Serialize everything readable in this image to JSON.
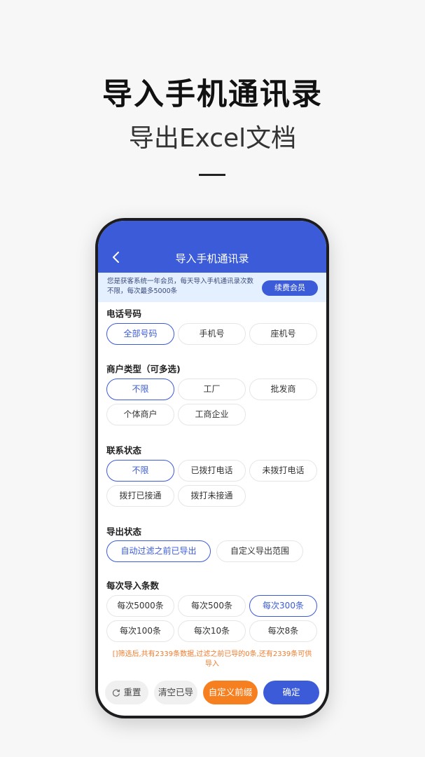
{
  "promo": {
    "title": "导入手机通讯录",
    "subtitle": "导出Excel文档"
  },
  "header": {
    "title": "导入手机通讯录",
    "back_icon": "chevron-left-icon"
  },
  "notice": {
    "text": "您是获客系统一年会员，每天导入手机通讯录次数不限，每次最多5000条",
    "renew_label": "续费会员"
  },
  "sections": {
    "phone": {
      "title": "电话号码",
      "options": [
        "全部号码",
        "手机号",
        "座机号"
      ],
      "selected": "全部号码"
    },
    "merchant": {
      "title": "商户类型（可多选)",
      "options": [
        "不限",
        "工厂",
        "批发商",
        "个体商户",
        "工商企业"
      ],
      "selected": "不限"
    },
    "contact": {
      "title": "联系状态",
      "options": [
        "不限",
        "已拨打电话",
        "未拨打电话",
        "拨打已接通",
        "拨打未接通"
      ],
      "selected": "不限"
    },
    "export": {
      "title": "导出状态",
      "options": [
        "自动过滤之前已导出",
        "自定义导出范围"
      ],
      "selected": "自动过滤之前已导出"
    },
    "count": {
      "title": "每次导入条数",
      "options": [
        "每次5000条",
        "每次500条",
        "每次300条",
        "每次100条",
        "每次10条",
        "每次8条"
      ],
      "selected": "每次300条"
    }
  },
  "hint": "[]筛选后,共有2339条数据,过滤之前已导的0条,还有2339条可供导入",
  "bottom": {
    "reset_label": "重置",
    "clear_label": "清空已导",
    "prefix_label": "自定义前缀",
    "confirm_label": "确定",
    "reset_icon": "refresh-icon"
  },
  "colors": {
    "primary": "#3b5bd8",
    "accent": "#f6801f",
    "notice_bg": "#e4efff"
  }
}
